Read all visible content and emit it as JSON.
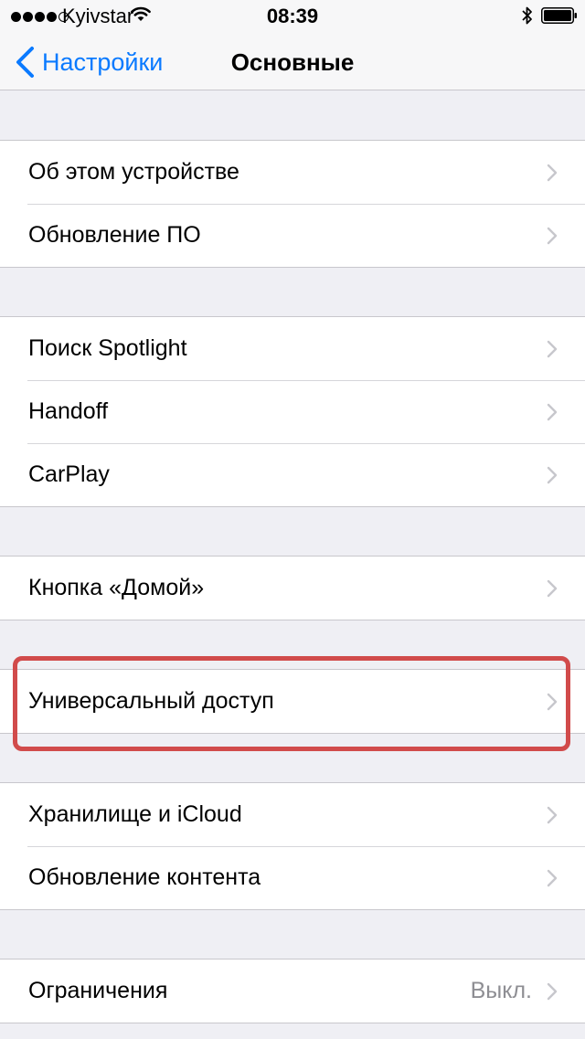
{
  "status_bar": {
    "carrier": "Kyivstar",
    "time": "08:39",
    "signal_bars_filled": 4,
    "signal_bars_total": 5
  },
  "nav": {
    "back_label": "Настройки",
    "title": "Основные"
  },
  "groups": [
    {
      "items": [
        {
          "label": "Об этом устройстве"
        },
        {
          "label": "Обновление ПО"
        }
      ]
    },
    {
      "items": [
        {
          "label": "Поиск Spotlight"
        },
        {
          "label": "Handoff"
        },
        {
          "label": "CarPlay"
        }
      ]
    },
    {
      "items": [
        {
          "label": "Кнопка «Домой»"
        }
      ]
    },
    {
      "items": [
        {
          "label": "Универсальный доступ",
          "highlighted": true
        }
      ]
    },
    {
      "items": [
        {
          "label": "Хранилище и iCloud"
        },
        {
          "label": "Обновление контента"
        }
      ]
    },
    {
      "items": [
        {
          "label": "Ограничения",
          "value": "Выкл."
        }
      ]
    }
  ],
  "colors": {
    "accent": "#0a7aff",
    "highlight_border": "#d14b4b",
    "background": "#efeff4",
    "secondary_text": "#8e8e93",
    "chevron": "#c7c7cc"
  },
  "icons": {
    "back": "chevron-left-icon",
    "disclosure": "chevron-right-icon",
    "wifi": "wifi-icon",
    "bluetooth": "bluetooth-icon",
    "battery": "battery-icon"
  }
}
